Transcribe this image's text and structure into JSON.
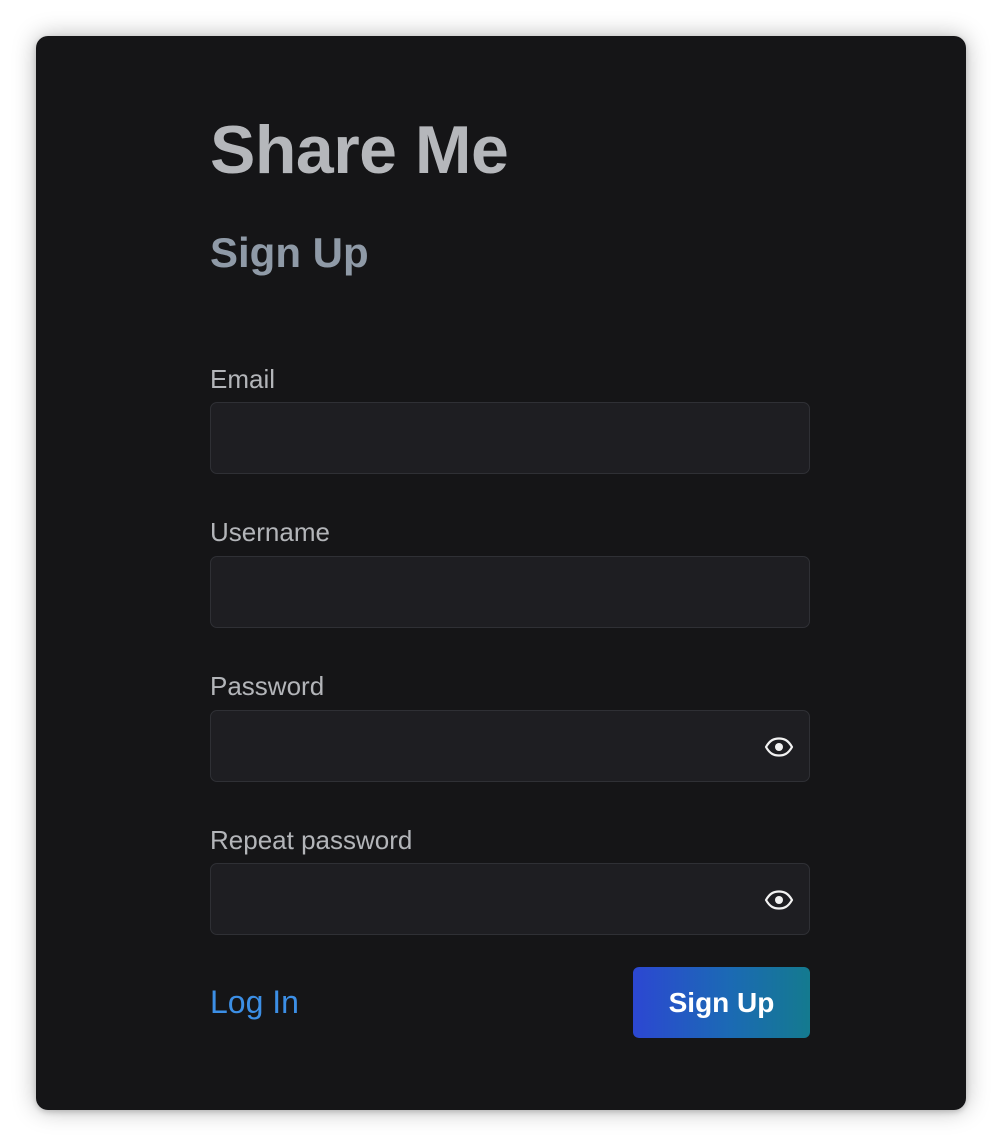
{
  "app": {
    "title": "Share Me"
  },
  "form": {
    "heading": "Sign Up",
    "fields": [
      {
        "label": "Email",
        "value": "",
        "placeholder": ""
      },
      {
        "label": "Username",
        "value": "",
        "placeholder": ""
      },
      {
        "label": "Password",
        "value": "",
        "placeholder": "",
        "icon": "eye-icon"
      },
      {
        "label": "Repeat password",
        "value": "",
        "placeholder": "",
        "icon": "eye-icon"
      }
    ],
    "login_link": "Log In",
    "submit_label": "Sign Up"
  },
  "colors": {
    "background": "#151517",
    "input_background": "#1e1e22",
    "link": "#3c8fe6",
    "button_gradient_start": "#2c47d2",
    "button_gradient_end": "#147a8f"
  }
}
